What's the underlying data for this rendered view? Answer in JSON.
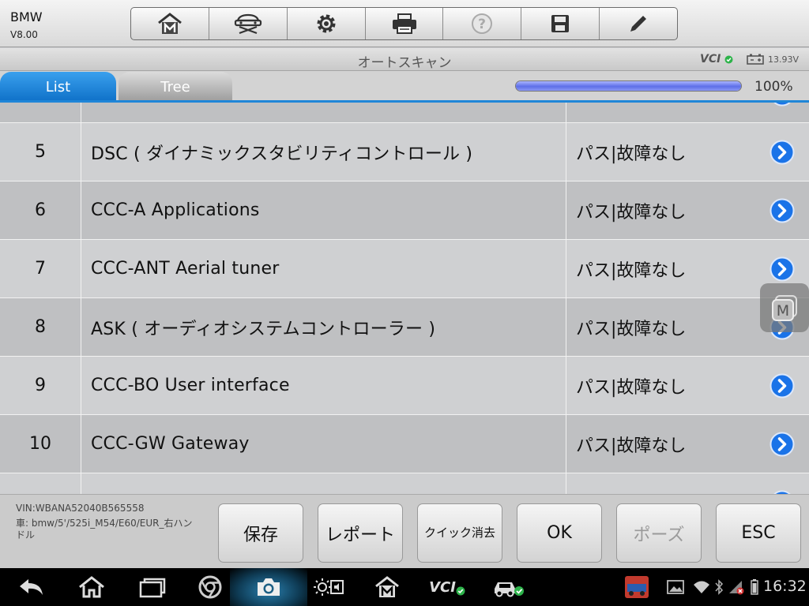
{
  "header": {
    "app_name": "BMW",
    "version": "V8.00",
    "toolbar": [
      "home-m-icon",
      "car-lift-icon",
      "gear-icon",
      "printer-icon",
      "help-icon",
      "save-disk-icon",
      "pencil-icon"
    ]
  },
  "titlebar": {
    "title": "オートスキャン",
    "vci": "VCI",
    "voltage": "13.93V"
  },
  "tabs": {
    "list": "List",
    "tree": "Tree"
  },
  "progress": {
    "value": 1.0,
    "label": "100%"
  },
  "rows": [
    {
      "num": "",
      "name": "",
      "status": "",
      "partial": true
    },
    {
      "num": "5",
      "name": "DSC ( ダイナミックスタビリティコントロール )",
      "status": "パス|故障なし"
    },
    {
      "num": "6",
      "name": "CCC-A Applications",
      "status": "パス|故障なし"
    },
    {
      "num": "7",
      "name": "CCC-ANT Aerial tuner",
      "status": "パス|故障なし"
    },
    {
      "num": "8",
      "name": "ASK ( オーディオシステムコントローラー )",
      "status": "パス|故障なし"
    },
    {
      "num": "9",
      "name": "CCC-BO User interface",
      "status": "パス|故障なし"
    },
    {
      "num": "10",
      "name": "CCC-GW Gateway",
      "status": "パス|故障なし"
    },
    {
      "num": "",
      "name": "",
      "status": "",
      "partial": true
    }
  ],
  "footer": {
    "vin": "VIN:WBANA52040B565558",
    "vehicle": "車: bmw/5'/525i_M54/E60/EUR_右ハンドル",
    "buttons": {
      "save": "保存",
      "report": "レポート",
      "quick_erase": "クイック消去",
      "ok": "OK",
      "pause": "ポーズ",
      "esc": "ESC"
    }
  },
  "statusbar": {
    "time": "16:32",
    "vci": "VCI"
  },
  "colors": {
    "accent": "#1f86d8",
    "arrow": "#1a73e8",
    "progress": "#5d6fe8"
  }
}
